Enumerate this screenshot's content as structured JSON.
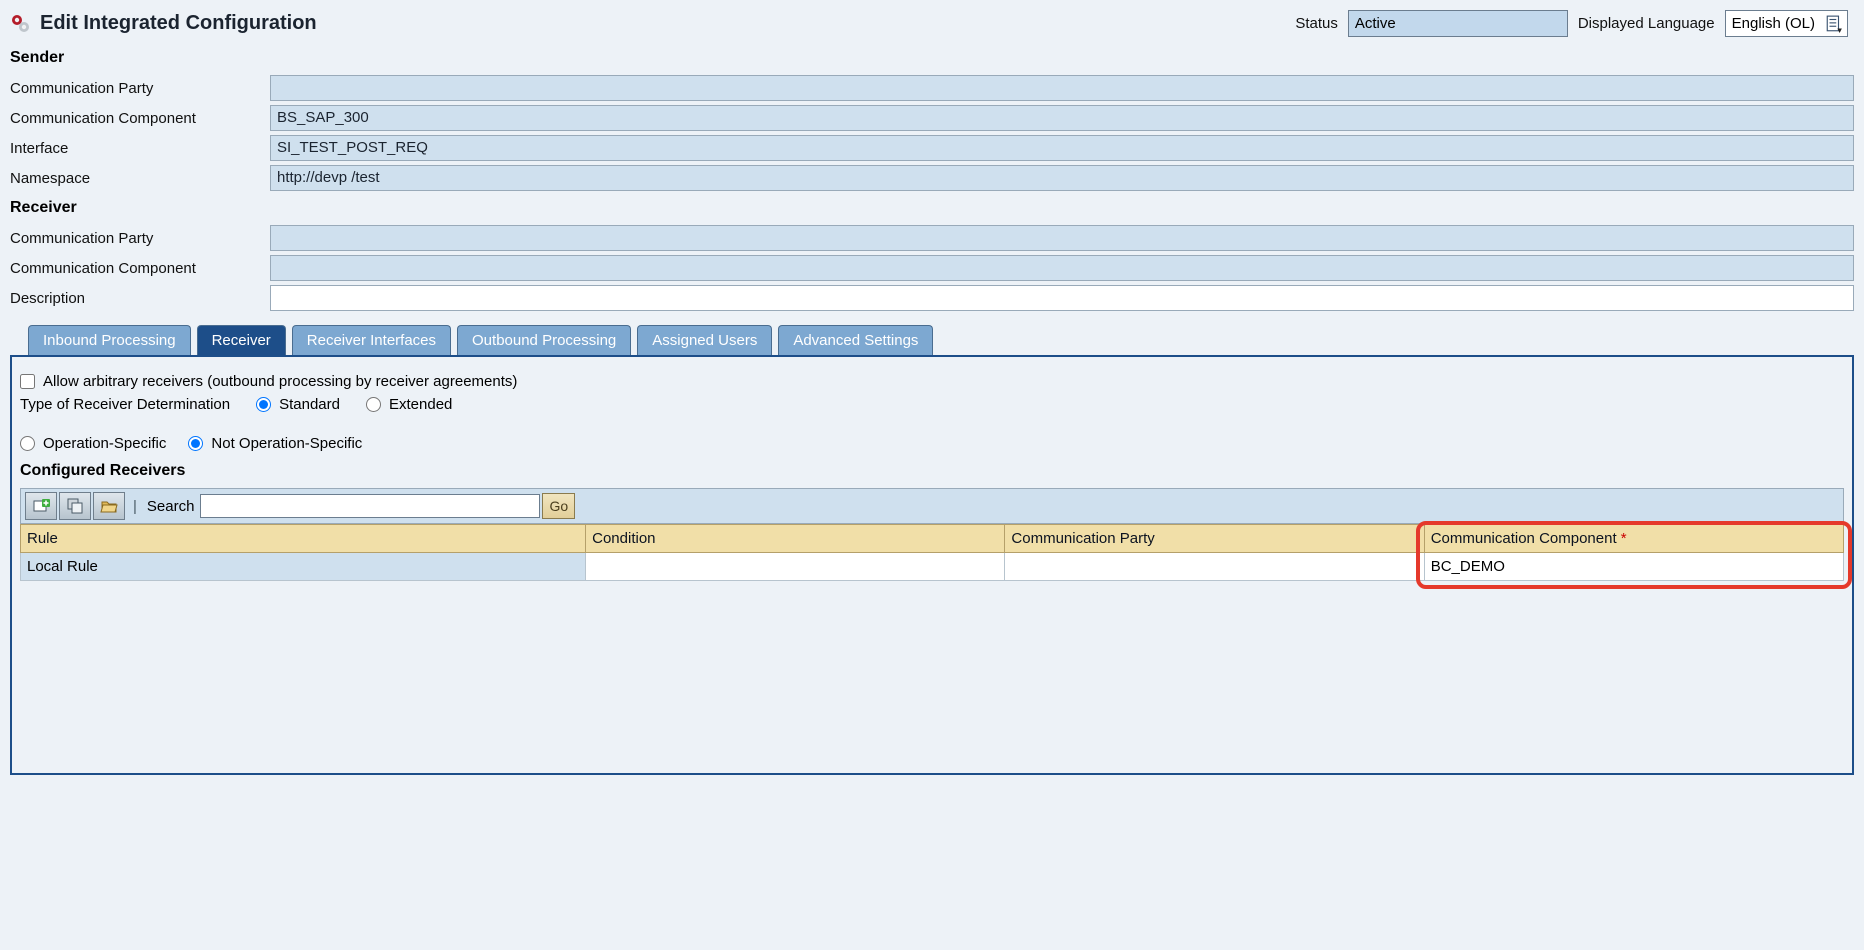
{
  "header": {
    "title": "Edit Integrated Configuration",
    "status_label": "Status",
    "status_value": "Active",
    "lang_label": "Displayed Language",
    "lang_value": "English (OL)"
  },
  "sender": {
    "heading": "Sender",
    "comm_party_label": "Communication Party",
    "comm_party_value": "",
    "comm_comp_label": "Communication Component",
    "comm_comp_value": "BS_SAP_300",
    "interface_label": "Interface",
    "interface_value": "SI_TEST_POST_REQ",
    "namespace_label": "Namespace",
    "namespace_value": "http://devp                               /test"
  },
  "receiver": {
    "heading": "Receiver",
    "comm_party_label": "Communication Party",
    "comm_party_value": "",
    "comm_comp_label": "Communication Component",
    "comm_comp_value": "",
    "description_label": "Description",
    "description_value": ""
  },
  "tabs": {
    "inbound": "Inbound Processing",
    "receiver": "Receiver",
    "receiver_interfaces": "Receiver Interfaces",
    "outbound": "Outbound Processing",
    "assigned_users": "Assigned Users",
    "advanced": "Advanced Settings"
  },
  "receiver_tab": {
    "allow_arbitrary": "Allow arbitrary receivers (outbound processing by receiver agreements)",
    "type_label": "Type of Receiver Determination",
    "standard": "Standard",
    "extended": "Extended",
    "op_specific": "Operation-Specific",
    "not_op_specific": "Not Operation-Specific",
    "configured": "Configured Receivers",
    "search_label": "Search",
    "go_label": "Go",
    "columns": {
      "rule": "Rule",
      "condition": "Condition",
      "comm_party": "Communication Party",
      "comm_comp": "Communication Component"
    },
    "rows": [
      {
        "rule": "Local Rule",
        "condition": "",
        "comm_party": "",
        "comm_comp": "BC_DEMO"
      }
    ]
  }
}
